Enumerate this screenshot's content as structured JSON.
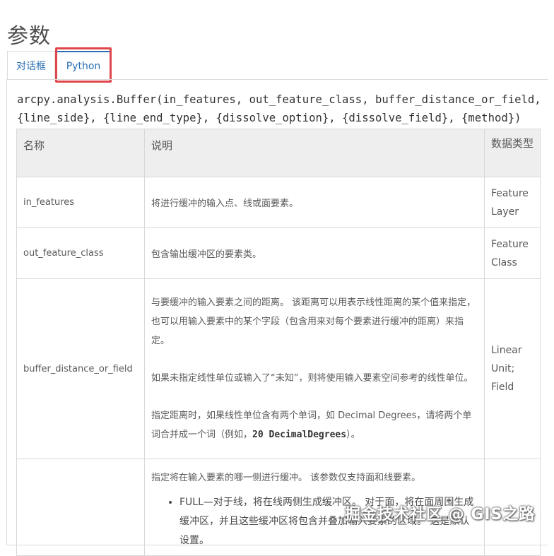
{
  "page_title": "参数",
  "tabs": [
    {
      "label": "对话框"
    },
    {
      "label": "Python"
    }
  ],
  "signature": "arcpy.analysis.Buffer(in_features, out_feature_class, buffer_distance_or_field, {line_side}, {line_end_type}, {dissolve_option}, {dissolve_field}, {method})",
  "table": {
    "headers": {
      "name": "名称",
      "desc": "说明",
      "type": "数据类型"
    },
    "rows": [
      {
        "name": "in_features",
        "desc": "将进行缓冲的输入点、线或面要素。",
        "type_lines": [
          "Feature",
          "Layer"
        ]
      },
      {
        "name": "out_feature_class",
        "desc": "包含输出缓冲区的要素类。",
        "type_lines": [
          "Feature",
          "Class"
        ]
      },
      {
        "name": "buffer_distance_or_field",
        "desc_p1": "与要缓冲的输入要素之间的距离。 该距离可以用表示线性距离的某个值来指定，也可以用输入要素中的某个字段（包含用来对每个要素进行缓冲的距离）来指定。",
        "desc_p2": "如果未指定线性单位或输入了“未知”，则将使用输入要素空间参考的线性单位。",
        "desc_p3_pre": "指定距离时，如果线性单位含有两个单词，如 Decimal Degrees，请将两个单词合并成一个词（例如，",
        "desc_p3_code": "20 DecimalDegrees",
        "desc_p3_post": "）。",
        "type_lines": [
          "Linear",
          "Unit;",
          "Field"
        ]
      },
      {
        "name": "",
        "desc": "指定将在输入要素的哪一侧进行缓冲。 该参数仅支持面和线要素。",
        "bullet": "FULL—对于线，将在线两侧生成缓冲区。 对于面，将在面周围生成缓冲区，并且这些缓冲区将包含并叠加输入要素的区域。 这是默认设置。",
        "type_lines": []
      }
    ]
  },
  "watermark": "掘金技术社区 @ GIS之路"
}
